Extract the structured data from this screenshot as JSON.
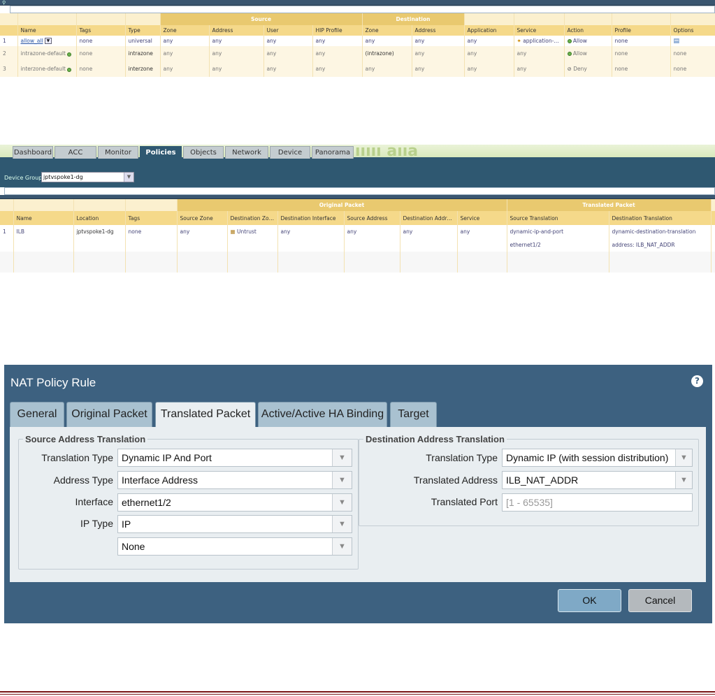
{
  "security_table": {
    "group_headers": {
      "source": "Source",
      "destination": "Destination"
    },
    "columns": [
      "Name",
      "Tags",
      "Type",
      "Zone",
      "Address",
      "User",
      "HIP Profile",
      "Zone",
      "Address",
      "Application",
      "Service",
      "Action",
      "Profile",
      "Options"
    ],
    "rows": [
      {
        "num": "1",
        "name": "allow_all",
        "tags": "none",
        "type": "universal",
        "src_zone": "any",
        "src_addr": "any",
        "user": "any",
        "hip": "any",
        "dst_zone": "any",
        "dst_addr": "any",
        "app": "any",
        "service": "application-d...",
        "action": "Allow",
        "profile": "none",
        "options": ""
      },
      {
        "num": "2",
        "name": "intrazone-default",
        "tags": "none",
        "type": "intrazone",
        "src_zone": "any",
        "src_addr": "any",
        "user": "any",
        "hip": "any",
        "dst_zone": "(intrazone)",
        "dst_addr": "any",
        "app": "any",
        "service": "any",
        "action": "Allow",
        "profile": "none",
        "options": "none"
      },
      {
        "num": "3",
        "name": "interzone-default",
        "tags": "none",
        "type": "interzone",
        "src_zone": "any",
        "src_addr": "any",
        "user": "any",
        "hip": "any",
        "dst_zone": "any",
        "dst_addr": "any",
        "app": "any",
        "service": "any",
        "action": "Deny",
        "profile": "none",
        "options": "none"
      }
    ]
  },
  "nav": {
    "tabs": [
      "Dashboard",
      "ACC",
      "Monitor",
      "Policies",
      "Objects",
      "Network",
      "Device",
      "Panorama"
    ],
    "active_tab": "Policies",
    "background_text": "ııııı aııa",
    "device_group_label": "Device Group",
    "device_group_value": "jptvspoke1-dg"
  },
  "nat_table": {
    "group_headers": {
      "original": "Original Packet",
      "translated": "Translated Packet"
    },
    "columns": [
      "Name",
      "Location",
      "Tags",
      "Source Zone",
      "Destination Zone",
      "Destination Interface",
      "Source Address",
      "Destination Address",
      "Service",
      "Source Translation",
      "Destination Translation"
    ],
    "row": {
      "num": "1",
      "name": "ILB",
      "location": "jptvspoke1-dg",
      "tags": "none",
      "src_zone": "any",
      "dst_zone": "Untrust",
      "dst_iface": "any",
      "src_addr": "any",
      "dst_addr": "any",
      "service": "any",
      "src_trans_1": "dynamic-ip-and-port",
      "src_trans_2": "ethernet1/2",
      "dst_trans_1": "dynamic-destination-translation",
      "dst_trans_2": "address: ILB_NAT_ADDR"
    }
  },
  "dialog": {
    "title": "NAT Policy Rule",
    "help": "?",
    "tabs": [
      "General",
      "Original Packet",
      "Translated Packet",
      "Active/Active HA Binding",
      "Target"
    ],
    "active_tab": "Translated Packet",
    "source": {
      "legend": "Source Address Translation",
      "translation_type_label": "Translation Type",
      "translation_type": "Dynamic IP And Port",
      "address_type_label": "Address Type",
      "address_type": "Interface Address",
      "interface_label": "Interface",
      "interface": "ethernet1/2",
      "ip_type_label": "IP Type",
      "ip_type": "IP",
      "extra": "None"
    },
    "destination": {
      "legend": "Destination Address Translation",
      "translation_type_label": "Translation Type",
      "translation_type": "Dynamic IP (with session distribution)",
      "translated_address_label": "Translated Address",
      "translated_address": "ILB_NAT_ADDR",
      "translated_port_label": "Translated Port",
      "translated_port_placeholder": "[1 - 65535]"
    },
    "ok": "OK",
    "cancel": "Cancel"
  }
}
